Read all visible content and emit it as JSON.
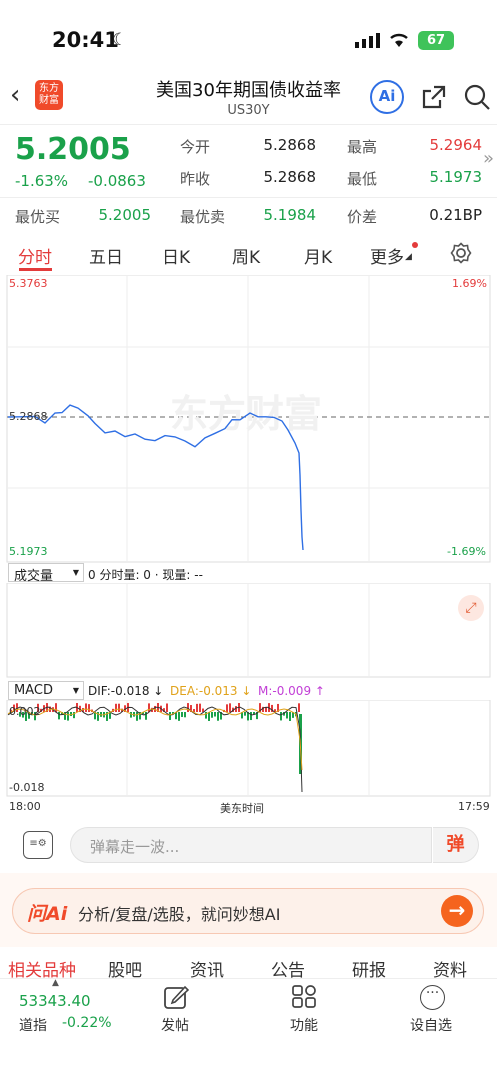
{
  "status": {
    "time": "20:41",
    "battery": "67"
  },
  "header": {
    "title": "美国30年期国债收益率",
    "code": "US30Y",
    "logo_text": "东方财富",
    "ai_label": "Ai"
  },
  "quote": {
    "price": "5.2005",
    "chg_pct": "-1.63%",
    "chg": "-0.0863",
    "open_label": "今开",
    "open": "5.2868",
    "high_label": "最高",
    "high": "5.2964",
    "prev_label": "昨收",
    "prev": "5.2868",
    "low_label": "最低",
    "low": "5.1973",
    "bid_label": "最优买",
    "bid": "5.2005",
    "ask_label": "最优卖",
    "ask": "5.1984",
    "spread_label": "价差",
    "spread": "0.21BP"
  },
  "tabs": [
    "分时",
    "五日",
    "日K",
    "周K",
    "月K",
    "更多"
  ],
  "chart": {
    "y_top": "5.3763",
    "y_mid": "5.2868",
    "y_bot": "5.1973",
    "pct_top": "1.69%",
    "pct_bot": "-1.69%",
    "watermark": "东方财富",
    "x_start": "18:00",
    "x_mid": "美东时间",
    "x_end": "17:59"
  },
  "volume": {
    "selector": "成交量",
    "text": "0 分时量: 0 · 现量: --"
  },
  "macd": {
    "selector": "MACD",
    "dif": "DIF:-0.018 ↓",
    "dea": "DEA:-0.013 ↓",
    "m": "M:-0.009 ↑",
    "y_top": "0.002",
    "y_bot": "-0.018"
  },
  "comment": {
    "placeholder": "弹幕走一波...",
    "danmu_label": "弹"
  },
  "ai_bar": {
    "logo": "问Ai",
    "text": "分析/复盘/选股，就问妙想AI"
  },
  "bottom_tabs": [
    "相关品种",
    "股吧",
    "资讯",
    "公告",
    "研报",
    "资料"
  ],
  "bottom_nav": {
    "index_value": "53343.40",
    "index_name": "道指",
    "index_chg": "-0.22%",
    "post": "发帖",
    "func": "功能",
    "custom": "设自选"
  },
  "colors": {
    "up": "#e33b3b",
    "down": "#1aa14a",
    "line": "#2f6fe4",
    "brand": "#f04a2a"
  }
}
